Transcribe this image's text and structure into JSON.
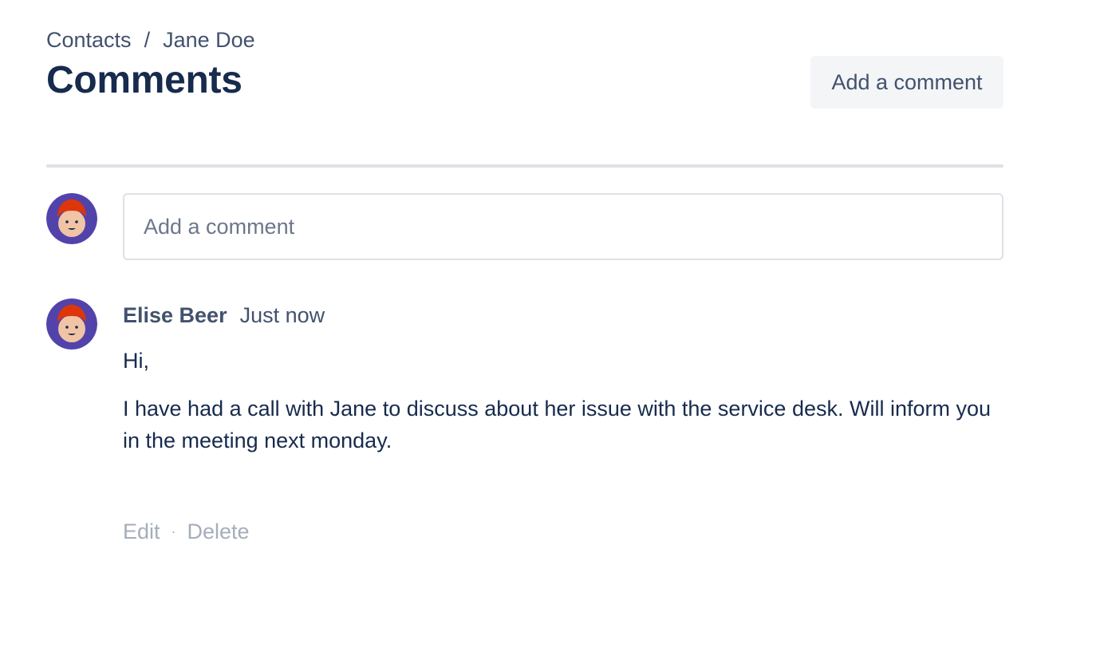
{
  "breadcrumb": {
    "items": [
      "Contacts",
      "Jane Doe"
    ],
    "separator": "/"
  },
  "header": {
    "title": "Comments",
    "add_button_label": "Add a comment"
  },
  "composer": {
    "placeholder": "Add a comment",
    "value": "",
    "avatar_icon": "user-avatar-icon"
  },
  "comments": [
    {
      "author": "Elise Beer",
      "time": "Just now",
      "paragraphs": [
        "Hi,",
        "I have had a call with Jane to discuss about her issue with the service desk. Will inform you in the meeting next monday."
      ],
      "actions": {
        "edit": "Edit",
        "separator": "·",
        "delete": "Delete"
      }
    }
  ],
  "colors": {
    "avatar_bg": "#5243aa",
    "hair": "#de350b",
    "skin": "#f0c4a4",
    "text_primary": "#172b4d",
    "text_secondary": "#42526e",
    "text_muted": "#a5adba"
  }
}
